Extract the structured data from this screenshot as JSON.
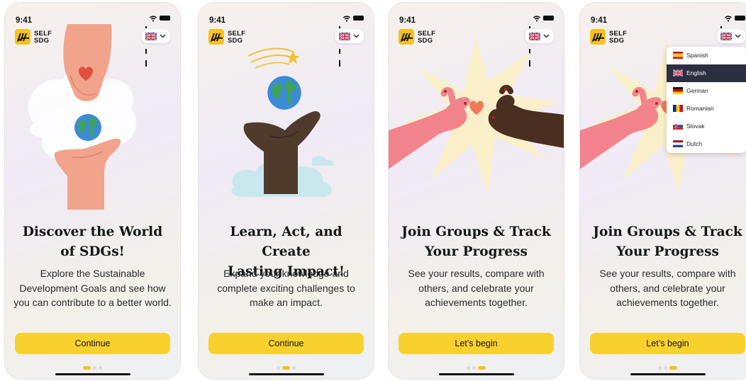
{
  "status_bar": {
    "time": "9:41"
  },
  "logo": {
    "line1": "SELF",
    "line2": "SDG"
  },
  "language_selector": {
    "flag_icon": "uk-flag-icon",
    "chevron_icon": "chevron-down-icon"
  },
  "screens": [
    {
      "title_line1": "Discover the World",
      "title_line2": "of SDGs!",
      "description": "Explore the Sustainable Development Goals and see how you can contribute to a better world.",
      "button_label": "Continue",
      "active_page": 1,
      "page_count": 3
    },
    {
      "title_line1": "Learn, Act, and Create",
      "title_line2": "Lasting Impact!",
      "description": "Expand your knowledge and complete exciting challenges to make an impact.",
      "button_label": "Continue",
      "active_page": 2,
      "page_count": 3
    },
    {
      "title_line1": "Join Groups & Track",
      "title_line2": "Your Progress",
      "description": "See your results, compare with others, and celebrate your achievements together.",
      "button_label": "Let’s begin",
      "active_page": 3,
      "page_count": 3
    },
    {
      "title_line1": "Join Groups & Track",
      "title_line2": "Your Progress",
      "description": "See your results, compare with others, and celebrate your achievements together.",
      "button_label": "Let’s begin",
      "active_page": 3,
      "page_count": 3
    }
  ],
  "language_dropdown": {
    "selected": "English",
    "options": [
      {
        "label": "Spanish",
        "flag_icon": "spain-flag-icon"
      },
      {
        "label": "English",
        "flag_icon": "uk-flag-icon"
      },
      {
        "label": "German",
        "flag_icon": "germany-flag-icon"
      },
      {
        "label": "Romanian",
        "flag_icon": "romania-flag-icon"
      },
      {
        "label": "Slovak",
        "flag_icon": "slovakia-flag-icon"
      },
      {
        "label": "Dutch",
        "flag_icon": "netherlands-flag-icon"
      }
    ]
  },
  "colors": {
    "accent_yellow": "#f9d12e",
    "dot_active": "#f6c21c",
    "dot_inactive": "#d9d9d9",
    "dropdown_selected_bg": "#2c2f3f"
  }
}
